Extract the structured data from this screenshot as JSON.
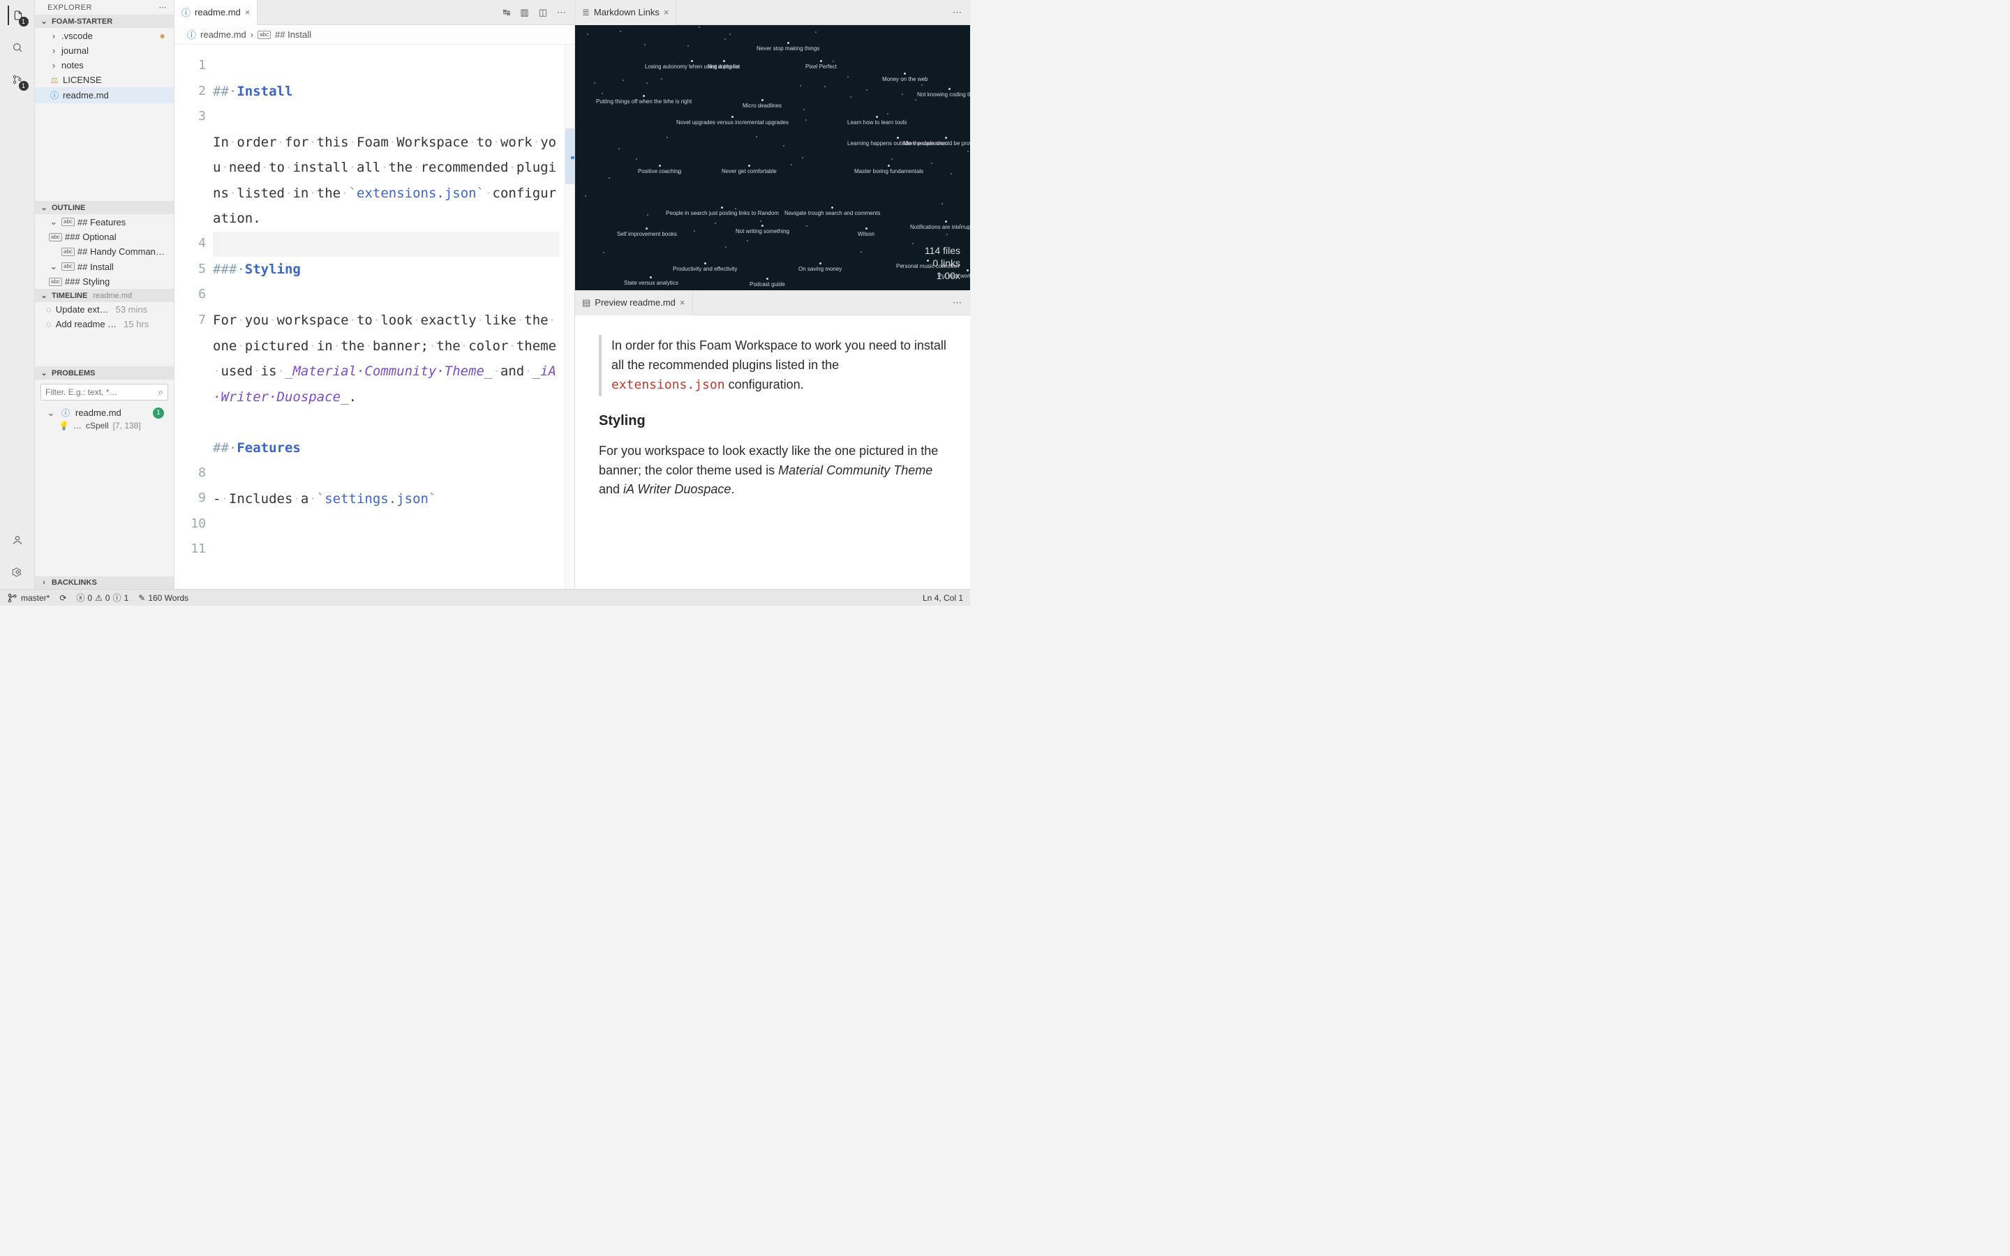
{
  "explorer": {
    "title": "EXPLORER",
    "folderTitle": "FOAM-STARTER",
    "tree": [
      {
        "name": ".vscode",
        "type": "folder",
        "modified": true
      },
      {
        "name": "journal",
        "type": "folder"
      },
      {
        "name": "notes",
        "type": "folder"
      },
      {
        "name": "LICENSE",
        "type": "file",
        "icon": "license"
      },
      {
        "name": "readme.md",
        "type": "file",
        "icon": "info",
        "selected": true
      }
    ]
  },
  "outline": {
    "title": "OUTLINE",
    "items": [
      {
        "label": "## Features",
        "depth": 0,
        "expanded": true
      },
      {
        "label": "### Optional",
        "depth": 1
      },
      {
        "label": "## Handy Comman…",
        "depth": 0
      },
      {
        "label": "## Install",
        "depth": 0,
        "expanded": true
      },
      {
        "label": "### Styling",
        "depth": 1
      }
    ]
  },
  "timeline": {
    "title": "TIMELINE",
    "file": "readme.md",
    "items": [
      {
        "label": "Update ext…",
        "time": "53 mins"
      },
      {
        "label": "Add readme …",
        "time": "15 hrs"
      }
    ]
  },
  "problems": {
    "title": "PROBLEMS",
    "filterPlaceholder": "Filter. E.g.: text, *…",
    "file": "readme.md",
    "badge": "1",
    "item": {
      "prefix": "…",
      "source": "cSpell",
      "loc": "[7, 138]"
    }
  },
  "backlinks": {
    "title": "BACKLINKS"
  },
  "editor": {
    "tab": "readme.md",
    "breadcrumb": [
      "readme.md",
      "## Install"
    ],
    "lines": {
      "l1": {
        "mark": "##·",
        "text": "Install"
      },
      "l3a": "In·order·for·this·Foam·",
      "l3b": "Workspace·to·work·you·need·to·",
      "l3c": "install·all·the·recommended·",
      "l3d": "plugins·listed·in·the·",
      "l3code": "extensions.json",
      "l3e": "configuration.",
      "l5": {
        "mark": "###·",
        "text": "Styling"
      },
      "l7a": "For·you·workspace·to·look·",
      "l7b": "exactly·like·the·one·pictured·",
      "l7c": "in·the·banner;·the·color·",
      "l7d": "theme·used·is·",
      "l7em1": "_Material·Community·Theme_",
      "l7mid": "·and·",
      "l7em2": "_iA·Writer·Duospace_",
      "l7end": ".",
      "l9": {
        "mark": "##·",
        "text": "Features"
      },
      "l11a": "-·Includes·a·",
      "l11code": "settings.json"
    },
    "gutter": [
      "1",
      "2",
      "3",
      "4",
      "5",
      "6",
      "7",
      "8",
      "9",
      "10",
      "11"
    ]
  },
  "graph": {
    "tab": "Markdown Links",
    "stats": {
      "files": "114 files",
      "links": "0 links",
      "zoom": "1.00x"
    },
    "nodes": [
      "Never stop making things",
      "Not doing list",
      "Losing autonomy when using a phone",
      "Pixel Perfect",
      "Money on the web",
      "Not knowing coding things",
      "Putting things off when the time is right",
      "Micro deadlines",
      "Learn how to learn tools",
      "Novel upgrades versus incremental upgrades",
      "Learning happens outside the classroom",
      "More people should be prototyping",
      "Positive coaching",
      "Never get comfortable",
      "Master boring fundamentals",
      "People in search just posting links to Random",
      "Navigate trough search and comments",
      "Notifications are interruptions",
      "Self improvement books",
      "Not writing something",
      "Wilson",
      "Productivity and effectivity",
      "On saving money",
      "Personal music collection",
      "Put your work in context",
      "State versus analytics",
      "Podcast guide"
    ]
  },
  "preview": {
    "tab": "Preview readme.md",
    "block_a": "In order for this Foam Workspace to work you need to install all the recommended plugins listed in the ",
    "block_code": "extensions.json",
    "block_b": " configuration.",
    "h3": "Styling",
    "p_a": "For you workspace to look exactly like the one pictured in the banner; the color theme used is ",
    "em1": "Material Community Theme",
    "p_mid": " and ",
    "em2": "iA Writer Duospace",
    "p_end": "."
  },
  "status": {
    "branch": "master*",
    "errors": "0",
    "warnings": "0",
    "info": "1",
    "words": "160 Words",
    "pos": "Ln 4, Col 1"
  },
  "activityBadges": {
    "explorer": "1",
    "scm": "1"
  }
}
